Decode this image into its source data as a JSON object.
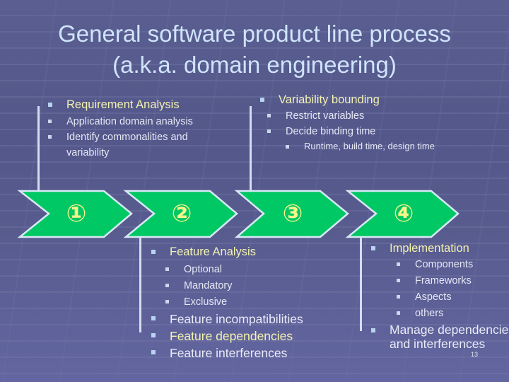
{
  "title": {
    "line1": "General software product line process",
    "line2": "(a.k.a. domain engineering)"
  },
  "steps": [
    {
      "label": "①",
      "step": 1
    },
    {
      "label": "②",
      "step": 2
    },
    {
      "label": "③",
      "step": 3
    },
    {
      "label": "④",
      "step": 4
    }
  ],
  "colors": {
    "chevron_fill": "#00c864",
    "chevron_border": "#d8e8f4",
    "heading_text": "#f4f2b0",
    "number_text": "#f6f58a",
    "title_text": "#cfe4fb",
    "background": "#575b8e"
  },
  "requirement_analysis": {
    "heading": "Requirement Analysis",
    "items": [
      "Application domain analysis",
      "Identify commonalities and",
      "variability"
    ]
  },
  "variability_bounding": {
    "heading": "Variability bounding",
    "items": [
      "Restrict variables",
      "Decide binding time"
    ],
    "subitems": [
      "Runtime, build time, design time"
    ]
  },
  "feature_analysis": {
    "heading": "Feature Analysis",
    "items": [
      "Optional",
      "Mandatory",
      "Exclusive"
    ],
    "after": [
      {
        "text": "Feature incompatibilities"
      },
      {
        "text": "Feature dependencies"
      },
      {
        "text": "Feature interferences"
      }
    ]
  },
  "implementation": {
    "heading": "Implementation",
    "items": [
      "Components",
      "Frameworks",
      "Aspects",
      "others"
    ],
    "after_line1": "Manage dependencies",
    "after_line2": "and interferences"
  },
  "page_number": "13"
}
